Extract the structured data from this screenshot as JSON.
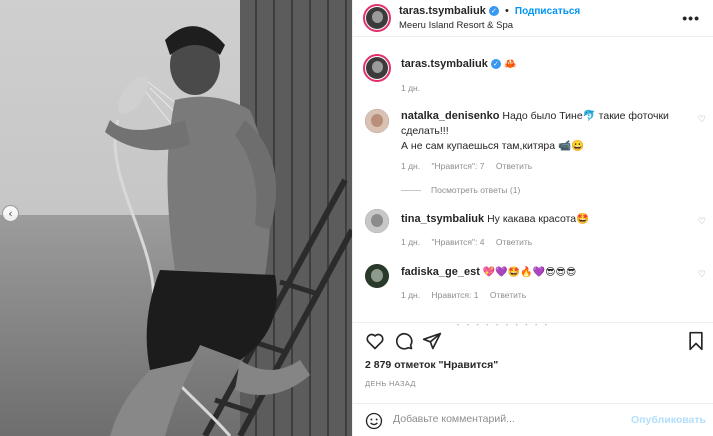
{
  "post": {
    "author": "taras.tsymbaliuk",
    "follow_label": "Подписаться",
    "separator": "•",
    "location": "Meeru Island Resort & Spa",
    "more_label": "•••",
    "caption_emoji": "🦀",
    "caption_time": "1 дн.",
    "carousel_prev": "‹"
  },
  "comments": [
    {
      "username": "natalka_denisenko",
      "text_line1": "Надо было Тине🐬 такие фоточки",
      "text_line2": "сделать!!!",
      "text_line3": "А не сам купаешься там,китяра 📹😀",
      "time": "1 дн.",
      "likes": "\"Нравится\": 7",
      "reply_label": "Ответить",
      "view_replies": "Посмотреть ответы (1)"
    },
    {
      "username": "tina_tsymbaliuk",
      "text": "Ну какава красота🤩",
      "time": "1 дн.",
      "likes": "\"Нравится\": 4",
      "reply_label": "Ответить"
    },
    {
      "username": "fadiska_ge_est",
      "text": "💖💜🤩🔥💜😎😎😎",
      "time": "1 дн.",
      "likes": "Нравится: 1",
      "reply_label": "Ответить"
    }
  ],
  "actions": {
    "like_icon": "heart-icon",
    "comment_icon": "comment-icon",
    "share_icon": "share-icon",
    "save_icon": "bookmark-icon",
    "carousel_dots": "• • • • • • • • • •"
  },
  "likes_text": "2 879 отметок \"Нравится\"",
  "date_text": "ДЕНЬ НАЗАД",
  "comment_box": {
    "placeholder": "Добавьте комментарий...",
    "publish_label": "Опубликовать"
  },
  "colors": {
    "accent": "#0095f6",
    "publish_disabled": "#b2dffc",
    "muted": "#8e8e8e",
    "text": "#262626"
  }
}
